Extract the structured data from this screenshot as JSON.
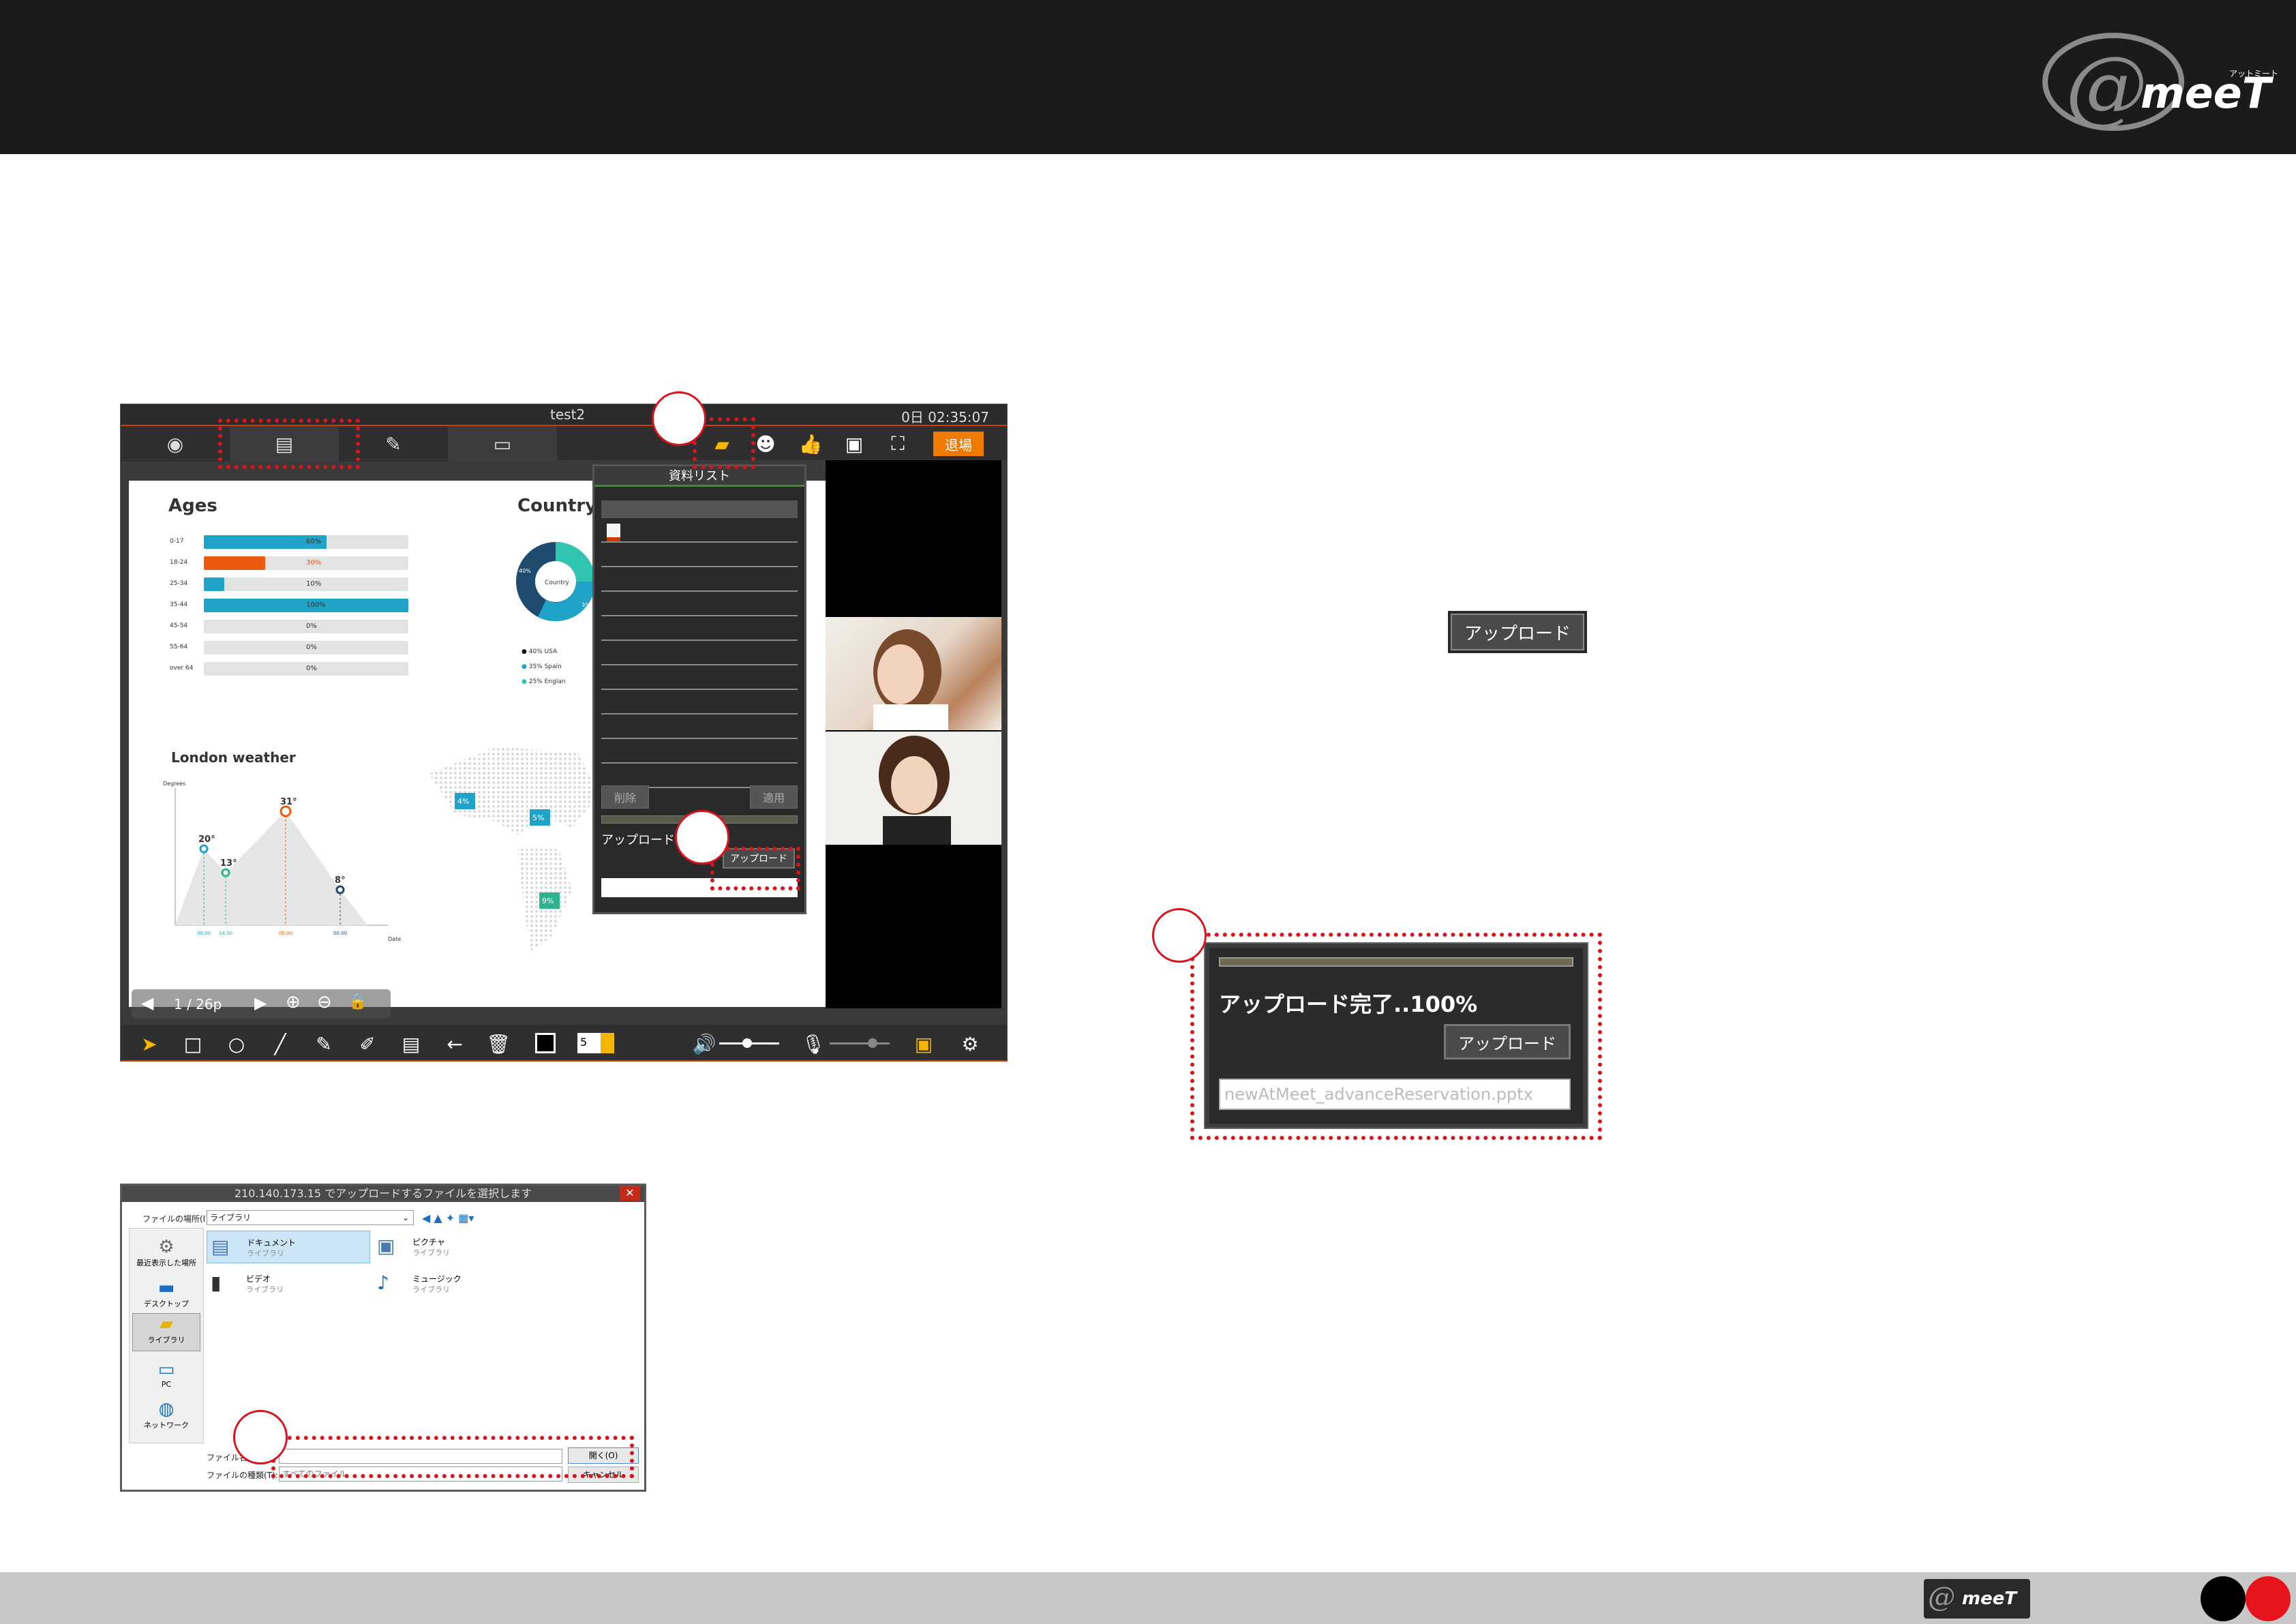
{
  "colors": {
    "accent": "#d23b00",
    "highlight": "#d8141d",
    "teal": "#1fa3c9",
    "orange": "#ec5a0f"
  },
  "app": {
    "title": "test2",
    "timer": "0日 02:35:07",
    "exit_label": "退場",
    "doc_panel": {
      "title": "資料リスト",
      "delete_label": "削除",
      "apply_label": "適用",
      "upload_status": "アップロード..",
      "upload_button": "アップロード"
    },
    "slide": {
      "ages_title": "Ages",
      "country_title": "Country",
      "country_center": "Country",
      "london_title": "London weather",
      "degrees_label": "Degrees",
      "date_label": "Date",
      "ages": [
        {
          "label": "0-17",
          "value": 60,
          "text": "60%"
        },
        {
          "label": "18-24",
          "value": 30,
          "text": "30%"
        },
        {
          "label": "25-34",
          "value": 10,
          "text": "10%"
        },
        {
          "label": "35-44",
          "value": 100,
          "text": "100%"
        },
        {
          "label": "45-54",
          "value": 0,
          "text": "0%"
        },
        {
          "label": "55-64",
          "value": 0,
          "text": "0%"
        },
        {
          "label": "over 64",
          "value": 0,
          "text": "0%"
        }
      ],
      "country_legend": [
        "40% USA",
        "35% Spain",
        "25% Englan"
      ],
      "donut_labels": [
        "40%",
        "35%"
      ],
      "weather": [
        {
          "temp": "20°",
          "date": "00.00"
        },
        {
          "temp": "13°",
          "date": "24.00"
        },
        {
          "temp": "31°",
          "date": "00.00"
        },
        {
          "temp": "8°",
          "date": "00.00"
        }
      ],
      "map_markers": [
        "4%",
        "5%",
        "9%"
      ],
      "page_indicator": "1  / 26p"
    },
    "font_size_value": "5"
  },
  "inset": {
    "upload_button": "アップロード",
    "complete_text": "アップロード完了..100%",
    "filename": "newAtMeet_advanceReservation.pptx"
  },
  "dialog": {
    "title": "210.140.173.15 でアップロードするファイルを選択します",
    "close": "✕",
    "location_label": "ファイルの場所(I):",
    "location_value": "ライブラリ",
    "places": [
      "最近表示した場所",
      "デスクトップ",
      "ライブラリ",
      "PC",
      "ネットワーク"
    ],
    "items": [
      {
        "name": "ドキュメント",
        "sub": "ライブラリ"
      },
      {
        "name": "ピクチャ",
        "sub": "ライブラリ"
      },
      {
        "name": "ビデオ",
        "sub": "ライブラリ"
      },
      {
        "name": "ミュージック",
        "sub": "ライブラリ"
      }
    ],
    "filename_label": "ファイル名(N):",
    "filetype_label": "ファイルの種類(T):",
    "filetype_value": "すべてのファイル",
    "open_button": "開く(O)",
    "cancel_button": "キャンセル"
  }
}
